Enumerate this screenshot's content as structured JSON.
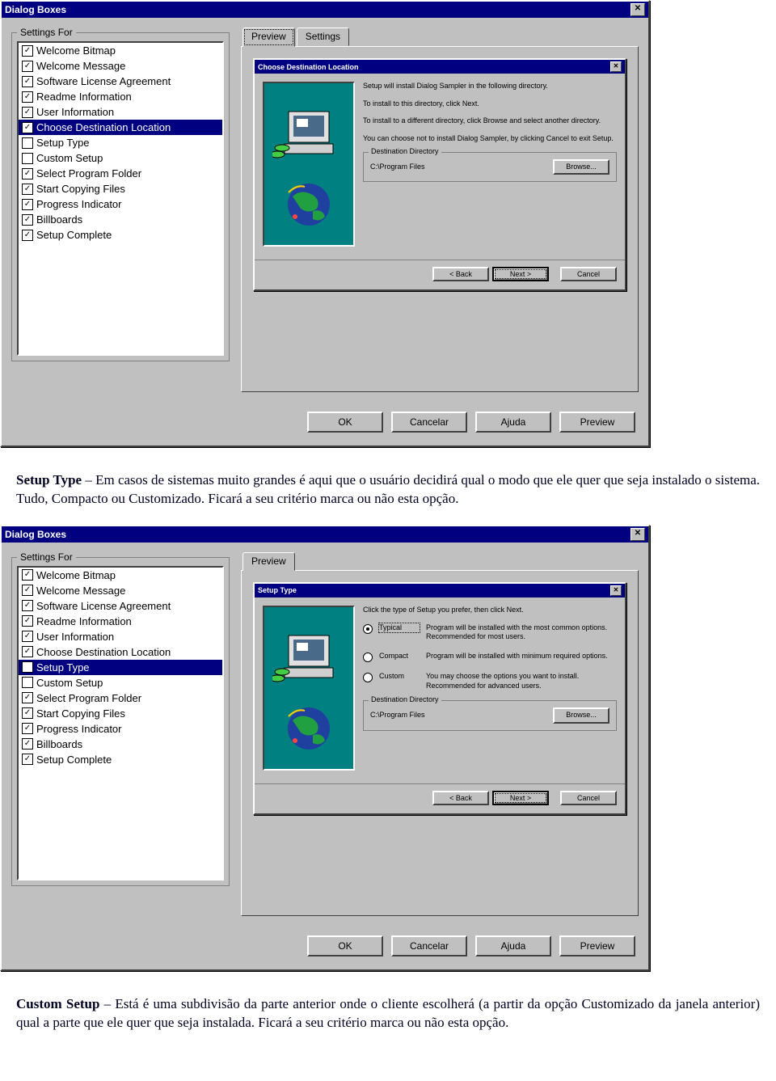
{
  "dialog": {
    "title": "Dialog Boxes",
    "settings_for": "Settings For",
    "items": [
      {
        "checked": true,
        "label": "Welcome Bitmap"
      },
      {
        "checked": true,
        "label": "Welcome Message"
      },
      {
        "checked": true,
        "label": "Software License Agreement"
      },
      {
        "checked": true,
        "label": "Readme Information"
      },
      {
        "checked": true,
        "label": "User Information"
      },
      {
        "checked": true,
        "label": "Choose Destination Location"
      },
      {
        "checked": false,
        "label": "Setup Type"
      },
      {
        "checked": false,
        "label": "Custom Setup"
      },
      {
        "checked": true,
        "label": "Select Program Folder"
      },
      {
        "checked": true,
        "label": "Start Copying Files"
      },
      {
        "checked": true,
        "label": "Progress Indicator"
      },
      {
        "checked": true,
        "label": "Billboards"
      },
      {
        "checked": true,
        "label": "Setup Complete"
      }
    ],
    "tabs": {
      "preview": "Preview",
      "settings": "Settings"
    },
    "buttons": {
      "ok": "OK",
      "cancel": "Cancelar",
      "help": "Ajuda",
      "preview": "Preview"
    }
  },
  "preview1": {
    "title": "Choose Destination Location",
    "p1": "Setup will install Dialog Sampler in the following directory.",
    "p2": "To install to this directory, click Next.",
    "p3": "To install to a different directory, click Browse and select another directory.",
    "p4": "You can choose not to install Dialog Sampler, by clicking Cancel to exit Setup.",
    "dest_label": "Destination Directory",
    "dest_path": "C:\\Program Files",
    "browse": "Browse...",
    "back": "< Back",
    "next": "Next >",
    "cancel": "Cancel"
  },
  "preview2": {
    "title": "Setup Type",
    "intro": "Click the type of Setup you prefer, then click Next.",
    "opts": [
      {
        "label": "Typical",
        "desc": "Program will be installed with the most common options. Recommended for most users.",
        "sel": true
      },
      {
        "label": "Compact",
        "desc": "Program will be installed with minimum required options.",
        "sel": false
      },
      {
        "label": "Custom",
        "desc": "You may choose the options you want to install. Recommended for advanced users.",
        "sel": false
      }
    ],
    "dest_label": "Destination Directory",
    "dest_path": "C:\\Program Files",
    "browse": "Browse...",
    "back": "< Back",
    "next": "Next >",
    "cancel": "Cancel"
  },
  "selected_index_1": 5,
  "selected_index_2": 6,
  "text": {
    "para1_bold": "Setup Type",
    "para1": " – Em casos de sistemas muito grandes é aqui que o usuário decidirá qual o modo que ele quer que seja instalado o sistema. Tudo, Compacto ou Customizado. Ficará a seu critério marca ou não esta opção.",
    "para2_bold": "Custom Setup",
    "para2": " – Está é uma subdivisão da parte anterior onde o cliente escolherá (a partir da opção Customizado da janela anterior) qual a parte que ele quer que seja instalada. Ficará a seu critério marca ou não esta opção."
  }
}
